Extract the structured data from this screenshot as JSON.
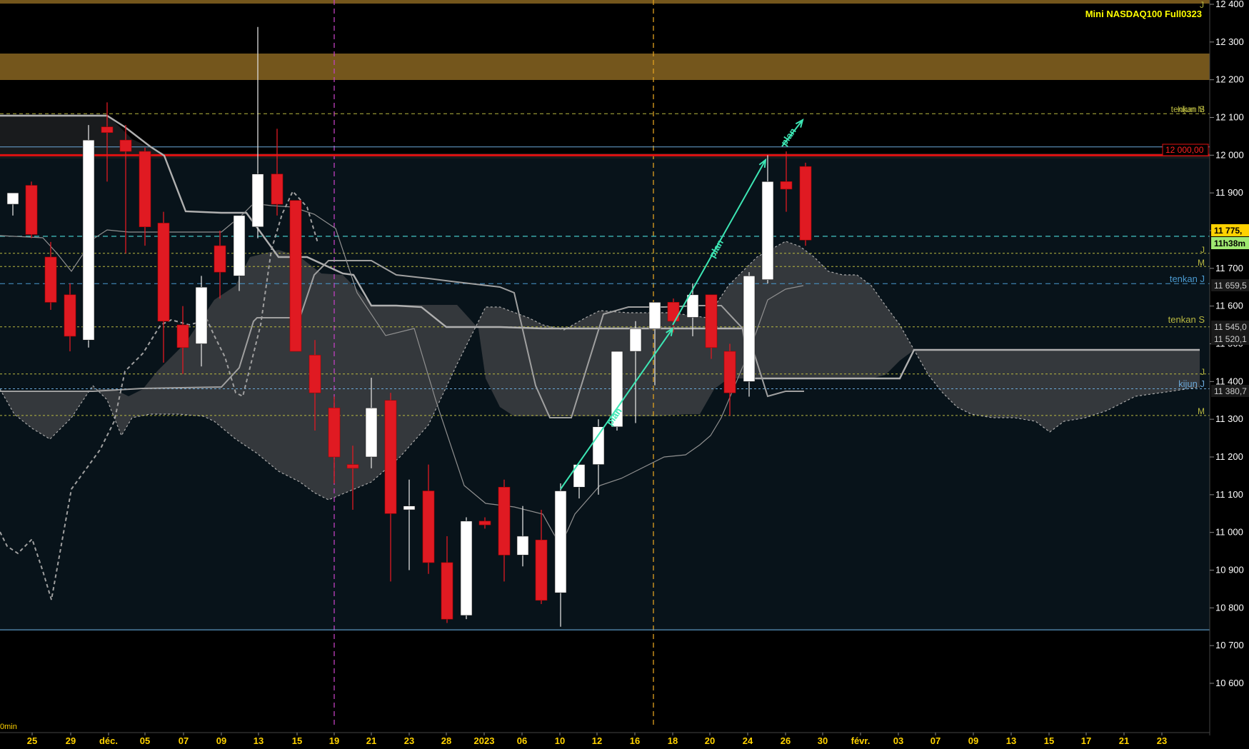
{
  "chart_data": {
    "type": "candlestick",
    "title": "Mini NASDAQ100 Full0323",
    "timeframe_label": "0min",
    "y_ticks": [
      10600,
      10700,
      10800,
      10900,
      11000,
      11100,
      11200,
      11300,
      11400,
      11500,
      11600,
      11700,
      11800,
      11900,
      12000,
      12100,
      12200,
      12300,
      12400
    ],
    "y_tick_labels": [
      "10 600",
      "10 700",
      "10 800",
      "10 900",
      "11 000",
      "11 100",
      "11 200",
      "11 300",
      "11 400",
      "11 500",
      "11 600",
      "11 700",
      "11 800",
      "11 900",
      "12 000",
      "12 100",
      "12 200",
      "12 300",
      "12 400"
    ],
    "x_tick_labels": [
      "25",
      "29",
      "déc.",
      "05",
      "07",
      "09",
      "13",
      "15",
      "19",
      "21",
      "23",
      "28",
      "2023",
      "06",
      "10",
      "12",
      "16",
      "18",
      "20",
      "24",
      "26",
      "30",
      "févr.",
      "03",
      "07",
      "09",
      "13",
      "15",
      "17",
      "21",
      "23"
    ],
    "candles": [
      {
        "o": 11870,
        "h": 11890,
        "l": 11840,
        "c": 11900
      },
      {
        "o": 11920,
        "h": 11930,
        "l": 11780,
        "c": 11790
      },
      {
        "o": 11730,
        "h": 11770,
        "l": 11590,
        "c": 11610
      },
      {
        "o": 11630,
        "h": 11660,
        "l": 11480,
        "c": 11520
      },
      {
        "o": 11510,
        "h": 12080,
        "l": 11490,
        "c": 12040
      },
      {
        "o": 12075,
        "h": 12140,
        "l": 11930,
        "c": 12060
      },
      {
        "o": 12040,
        "h": 12080,
        "l": 11740,
        "c": 12010
      },
      {
        "o": 12010,
        "h": 12020,
        "l": 11760,
        "c": 11810
      },
      {
        "o": 11820,
        "h": 11850,
        "l": 11450,
        "c": 11560
      },
      {
        "o": 11550,
        "h": 11600,
        "l": 11420,
        "c": 11490
      },
      {
        "o": 11500,
        "h": 11680,
        "l": 11440,
        "c": 11650
      },
      {
        "o": 11760,
        "h": 11800,
        "l": 11620,
        "c": 11690
      },
      {
        "o": 11680,
        "h": 11840,
        "l": 11640,
        "c": 11840
      },
      {
        "o": 11810,
        "h": 12340,
        "l": 11780,
        "c": 11950
      },
      {
        "o": 11950,
        "h": 12070,
        "l": 11840,
        "c": 11870
      },
      {
        "o": 11880,
        "h": 11880,
        "l": 11480,
        "c": 11480
      },
      {
        "o": 11470,
        "h": 11510,
        "l": 11270,
        "c": 11370
      },
      {
        "o": 11330,
        "h": 11360,
        "l": 11130,
        "c": 11200
      },
      {
        "o": 11180,
        "h": 11230,
        "l": 11060,
        "c": 11170
      },
      {
        "o": 11200,
        "h": 11410,
        "l": 11170,
        "c": 11330
      },
      {
        "o": 11350,
        "h": 11370,
        "l": 10870,
        "c": 11050
      },
      {
        "o": 11060,
        "h": 11140,
        "l": 10900,
        "c": 11070
      },
      {
        "o": 11110,
        "h": 11180,
        "l": 10890,
        "c": 10920
      },
      {
        "o": 10920,
        "h": 10990,
        "l": 10760,
        "c": 10770
      },
      {
        "o": 10780,
        "h": 11040,
        "l": 10770,
        "c": 11030
      },
      {
        "o": 11030,
        "h": 11040,
        "l": 11010,
        "c": 11020
      },
      {
        "o": 11120,
        "h": 11140,
        "l": 10870,
        "c": 10940
      },
      {
        "o": 10940,
        "h": 11070,
        "l": 10910,
        "c": 10990
      },
      {
        "o": 10980,
        "h": 11060,
        "l": 10810,
        "c": 10820
      },
      {
        "o": 10840,
        "h": 11130,
        "l": 10750,
        "c": 11110
      },
      {
        "o": 11120,
        "h": 11180,
        "l": 11090,
        "c": 11180
      },
      {
        "o": 11180,
        "h": 11300,
        "l": 11100,
        "c": 11280
      },
      {
        "o": 11280,
        "h": 11480,
        "l": 11270,
        "c": 11480
      },
      {
        "o": 11480,
        "h": 11560,
        "l": 11290,
        "c": 11540
      },
      {
        "o": 11540,
        "h": 11610,
        "l": 11390,
        "c": 11610
      },
      {
        "o": 11610,
        "h": 11620,
        "l": 11530,
        "c": 11560
      },
      {
        "o": 11570,
        "h": 11660,
        "l": 11520,
        "c": 11630
      },
      {
        "o": 11630,
        "h": 11630,
        "l": 11460,
        "c": 11490
      },
      {
        "o": 11480,
        "h": 11500,
        "l": 11310,
        "c": 11370
      },
      {
        "o": 11400,
        "h": 11690,
        "l": 11360,
        "c": 11680
      },
      {
        "o": 11670,
        "h": 12000,
        "l": 11660,
        "c": 11930
      },
      {
        "o": 11930,
        "h": 12010,
        "l": 11850,
        "c": 11910
      },
      {
        "o": 11970,
        "h": 11980,
        "l": 11760,
        "c": 11775
      }
    ],
    "levels": [
      {
        "value": 12000,
        "label": "12 000,00",
        "color": "#e01010"
      },
      {
        "value": 12020,
        "label": "",
        "color": "#6aa8d8"
      },
      {
        "value": 12110,
        "label": "tenkan S",
        "color": "#b8b840"
      },
      {
        "value": 12109,
        "label": "kijun M",
        "color": "#b8b840"
      },
      {
        "value": 11775,
        "label": "11 775,",
        "color": "#ffff00"
      },
      {
        "value": 11659.5,
        "label": "11 659,5",
        "color": "#4a9ad0"
      },
      {
        "value": 11545,
        "label": "11 545,0",
        "color": "#b8b840"
      },
      {
        "value": 11520.1,
        "label": "11 520,1",
        "color": "#cccccc"
      },
      {
        "value": 11380.7,
        "label": "11 380,7",
        "color": "#6aa8d8"
      },
      {
        "value": 10742,
        "label": "",
        "color": "#6aa8d8"
      }
    ],
    "right_tags": {
      "last_price": "11 775,",
      "timer": "11h38m",
      "level_12000": "12 000,00",
      "tenkan_j_val": "11 659,5",
      "tenkan_s_val": "11 545,0",
      "extra_val": "11 520,1",
      "kijun_j_val": "11 380,7"
    },
    "annotations": {
      "tenkan_j": "tenkan J",
      "tenkan_s": "tenkan S",
      "kijun_j": "kijun J",
      "kijun_m_top": "kijun M",
      "tenkan_s_top": "tenkan S",
      "j1": "J",
      "j2": "J",
      "j3": "J",
      "m1": "M",
      "m2": "M",
      "plan1": "plan",
      "plan2": "plan",
      "plan3": "plan"
    },
    "colors": {
      "background": "#000000",
      "plot_bg": "#08131a",
      "bull": "#ffffff",
      "bear": "#e01a22",
      "cloud": "#3c3f43",
      "resistance_zone": "#74561c",
      "arrow": "#3de6b4"
    }
  }
}
